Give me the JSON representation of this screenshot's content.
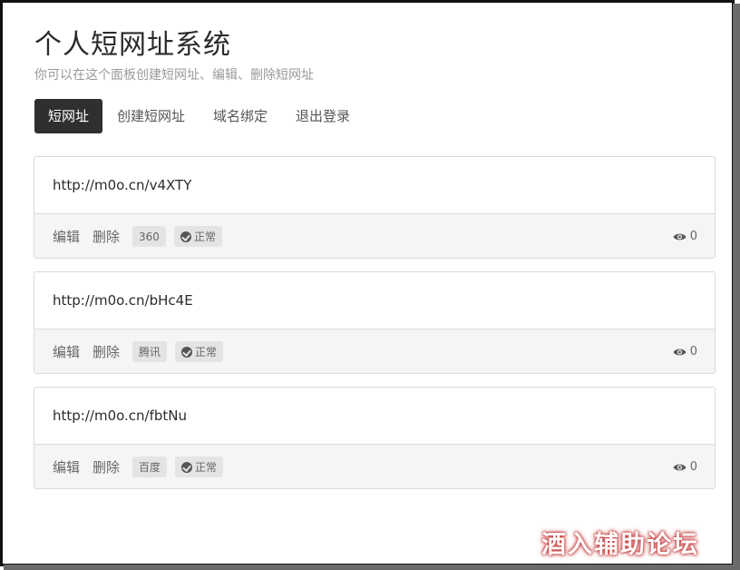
{
  "header": {
    "title": "个人短网址系统",
    "subtitle": "你可以在这个面板创建短网址、编辑、删除短网址"
  },
  "nav": {
    "tabs": [
      {
        "label": "短网址",
        "active": true
      },
      {
        "label": "创建短网址",
        "active": false
      },
      {
        "label": "域名绑定",
        "active": false
      },
      {
        "label": "退出登录",
        "active": false
      }
    ]
  },
  "links": [
    {
      "url": "http://m0o.cn/v4XTY",
      "edit_label": "编辑",
      "delete_label": "删除",
      "source": "360",
      "status": "正常",
      "views": "0"
    },
    {
      "url": "http://m0o.cn/bHc4E",
      "edit_label": "编辑",
      "delete_label": "删除",
      "source": "腾讯",
      "status": "正常",
      "views": "0"
    },
    {
      "url": "http://m0o.cn/fbtNu",
      "edit_label": "编辑",
      "delete_label": "删除",
      "source": "百度",
      "status": "正常",
      "views": "0"
    }
  ],
  "watermark": "酒入辅助论坛",
  "icons": {
    "status": "check-circle-icon",
    "views": "eye-icon"
  },
  "colors": {
    "active_tab_bg": "#2f2f2f",
    "tag_bg": "#e4e4e4",
    "footer_bg": "#f5f5f5"
  }
}
